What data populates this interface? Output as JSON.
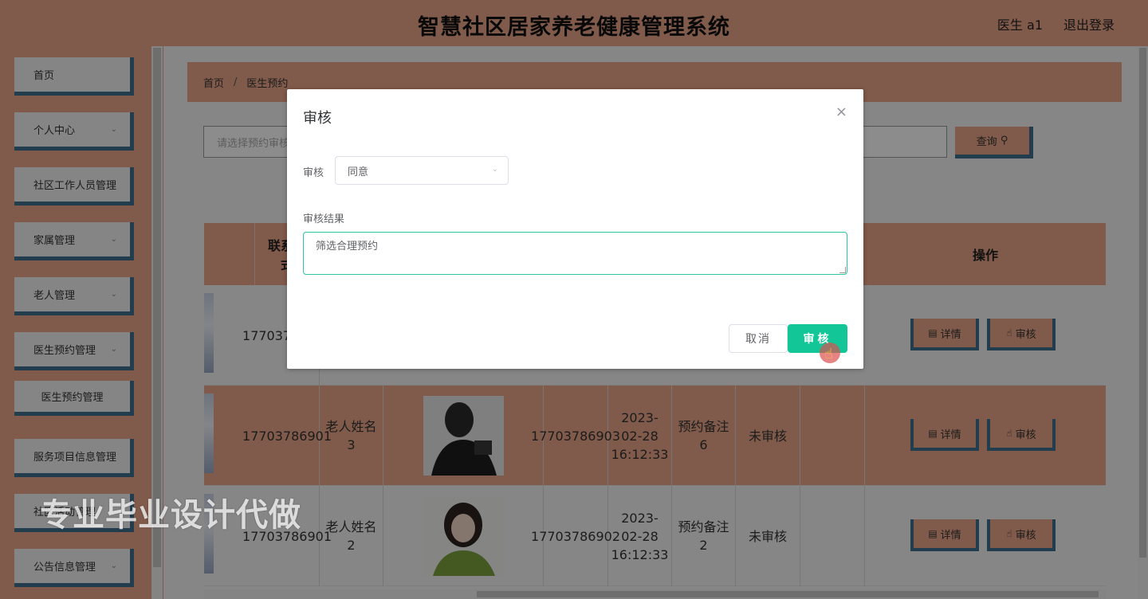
{
  "header": {
    "title": "智慧社区居家养老健康管理系统",
    "user": "医生 a1",
    "logout": "退出登录"
  },
  "sidebar": {
    "items": [
      {
        "label": "首页"
      },
      {
        "label": "个人中心"
      },
      {
        "label": "社区工作人员管理"
      },
      {
        "label": "家属管理"
      },
      {
        "label": "老人管理"
      },
      {
        "label": "医生预约管理"
      },
      {
        "label": "医生预约管理"
      },
      {
        "label": "服务项目信息管理"
      },
      {
        "label": "社区活动管理"
      },
      {
        "label": "公告信息管理"
      }
    ]
  },
  "breadcrumb": {
    "home": "首页",
    "separator": "/",
    "current": "医生预约"
  },
  "search": {
    "placeholder": "请选择预约审核",
    "button": "查询"
  },
  "table": {
    "headers": {
      "contact": "联系方式",
      "operation": "操作"
    },
    "rows": [
      {
        "contact": "17703786901",
        "name": "",
        "doctor_phone": "",
        "time": "",
        "remark": "",
        "status": "",
        "detail": "详情",
        "audit": "审核"
      },
      {
        "contact": "17703786901",
        "name": "老人姓名3",
        "doctor_phone": "17703786903",
        "time": "2023-02-28 16:12:33",
        "remark": "预约备注6",
        "status": "未审核",
        "detail": "详情",
        "audit": "审核"
      },
      {
        "contact": "17703786901",
        "name": "老人姓名2",
        "doctor_phone": "17703786902",
        "time": "2023-02-28 16:12:33",
        "remark": "预约备注2",
        "status": "未审核",
        "detail": "详情",
        "audit": "审核"
      }
    ]
  },
  "dialog": {
    "title": "审核",
    "close": "×",
    "field_audit_label": "审核",
    "field_audit_value": "同意",
    "field_result_label": "审核结果",
    "field_result_value": "筛选合理预约",
    "cancel": "取消",
    "confirm": "审核"
  },
  "watermark": "专业毕业设计代做",
  "colors": {
    "accent": "#e9a487",
    "border_blue": "#3f6f8f",
    "confirm_green": "#13c698"
  }
}
